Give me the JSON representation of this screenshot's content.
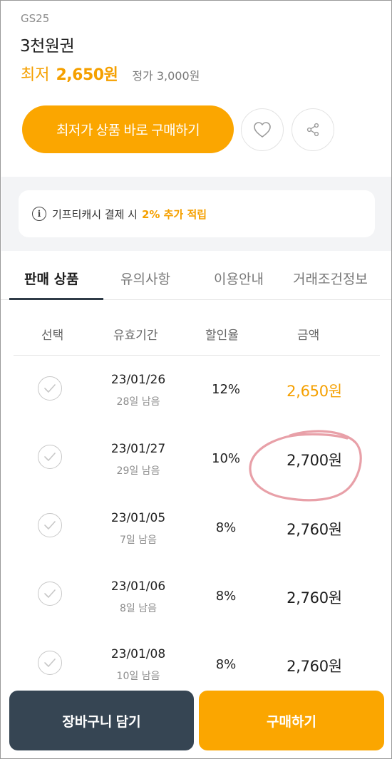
{
  "product": {
    "brand": "GS25",
    "title": "3천원권",
    "price_prefix": "최저",
    "lowest_price": "2,650원",
    "list_price": "정가 3,000원"
  },
  "actions": {
    "buy_lowest_label": "최저가 상품 바로 구매하기",
    "like_icon": "heart-icon",
    "share_icon": "share-icon"
  },
  "notice": {
    "icon": "info-icon",
    "text": "기프티캐시 결제 시",
    "highlight": "2% 추가 적립"
  },
  "tabs": [
    {
      "label": "판매 상품",
      "active": true
    },
    {
      "label": "유의사항",
      "active": false
    },
    {
      "label": "이용안내",
      "active": false
    },
    {
      "label": "거래조건정보",
      "active": false
    }
  ],
  "table": {
    "headers": [
      "선택",
      "유효기간",
      "할인율",
      "금액"
    ],
    "rows": [
      {
        "date": "23/01/26",
        "remain": "28일 남음",
        "rate": "12%",
        "amount": "2,650원",
        "lowest": true
      },
      {
        "date": "23/01/27",
        "remain": "29일 남음",
        "rate": "10%",
        "amount": "2,700원",
        "lowest": false
      },
      {
        "date": "23/01/05",
        "remain": "7일 남음",
        "rate": "8%",
        "amount": "2,760원",
        "lowest": false
      },
      {
        "date": "23/01/06",
        "remain": "8일 남음",
        "rate": "8%",
        "amount": "2,760원",
        "lowest": false
      },
      {
        "date": "23/01/08",
        "remain": "10일 남음",
        "rate": "8%",
        "amount": "2,760원",
        "lowest": false
      }
    ]
  },
  "bottom": {
    "cart_label": "장바구니 담기",
    "buy_label": "구매하기"
  },
  "colors": {
    "accent": "#fba600",
    "price_text": "#f5a000",
    "dark_button": "#364553",
    "annotation": "#e8a0a8"
  }
}
